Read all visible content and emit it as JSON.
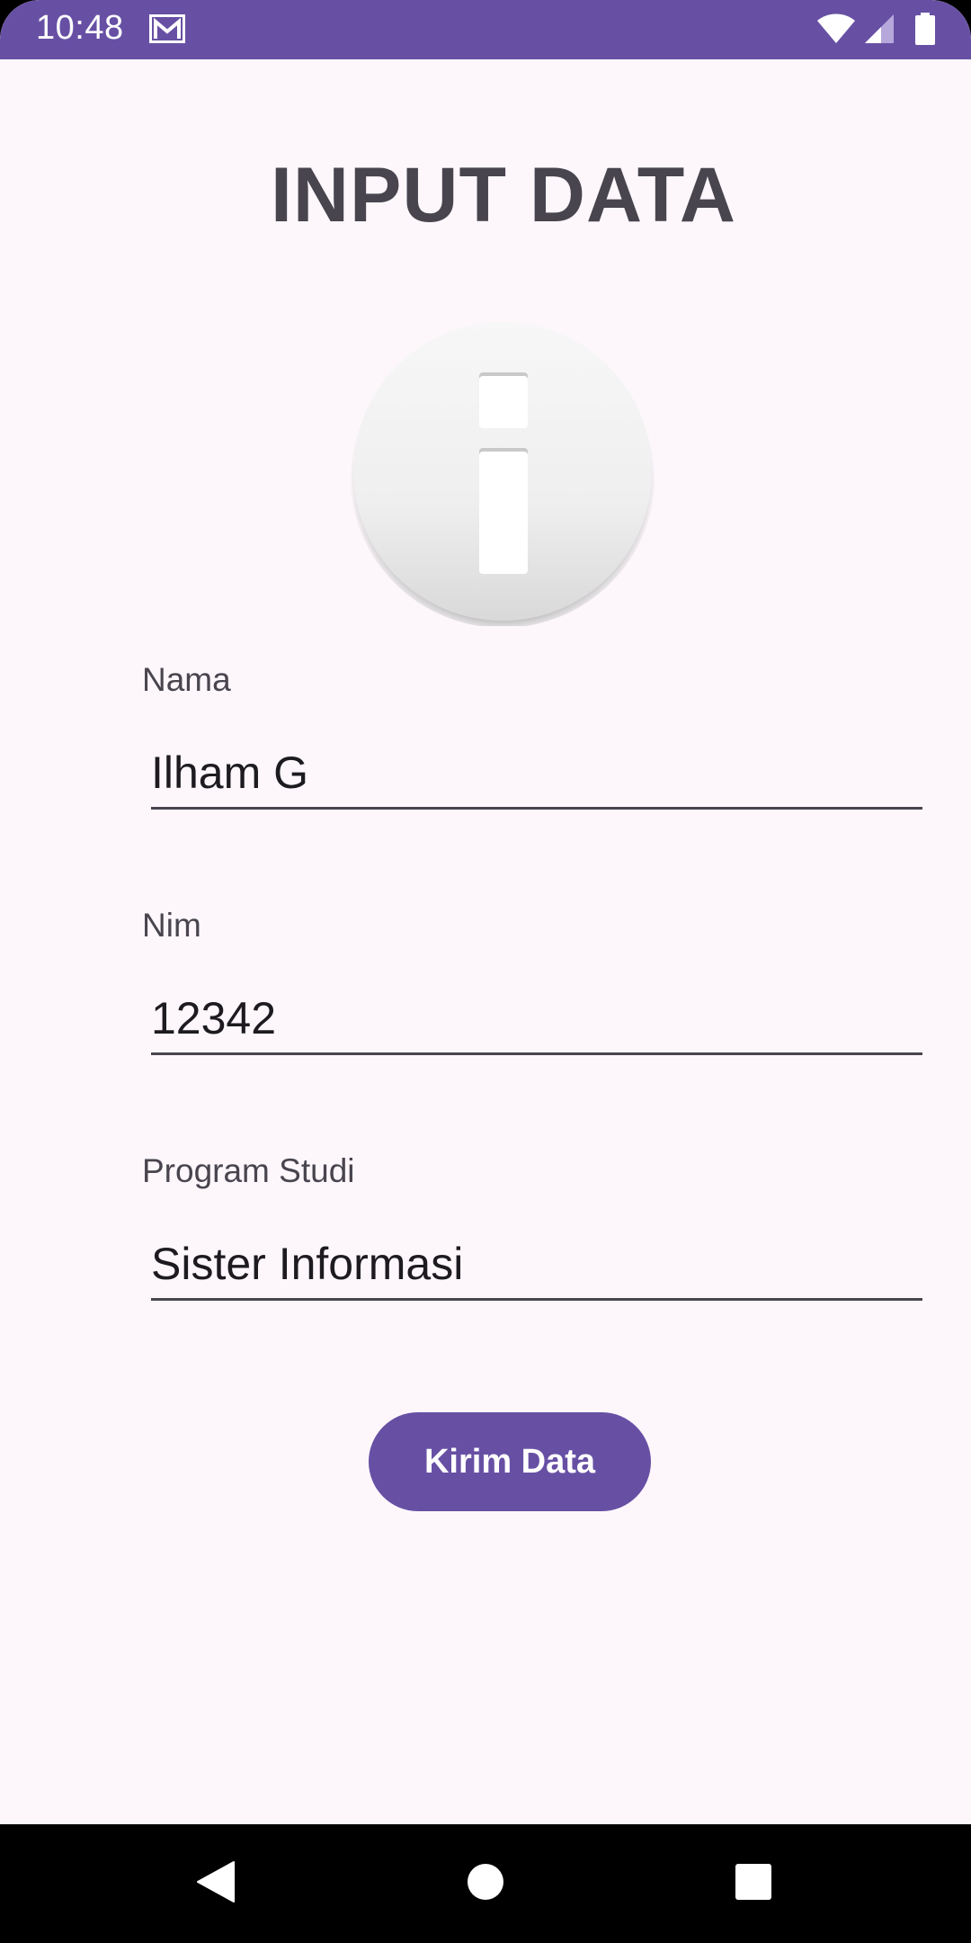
{
  "status_bar": {
    "time": "10:48",
    "background": "#6750a4",
    "icons": [
      "gmail-icon",
      "wifi-icon",
      "cellular-signal-icon",
      "battery-icon"
    ]
  },
  "page": {
    "title": "INPUT DATA",
    "image_icon": "info-icon"
  },
  "form": {
    "nama": {
      "label": "Nama",
      "value": "Ilham G"
    },
    "nim": {
      "label": "Nim",
      "value": "12342"
    },
    "program_studi": {
      "label": "Program Studi",
      "value": "Sister Informasi"
    },
    "submit_label": "Kirim Data"
  },
  "navigation": {
    "icons": [
      "back-icon",
      "home-icon",
      "recents-icon"
    ]
  },
  "colors": {
    "accent": "#6750a4",
    "background": "#fdf7fc",
    "text_primary": "#1d1b20",
    "text_secondary": "#49454f"
  }
}
